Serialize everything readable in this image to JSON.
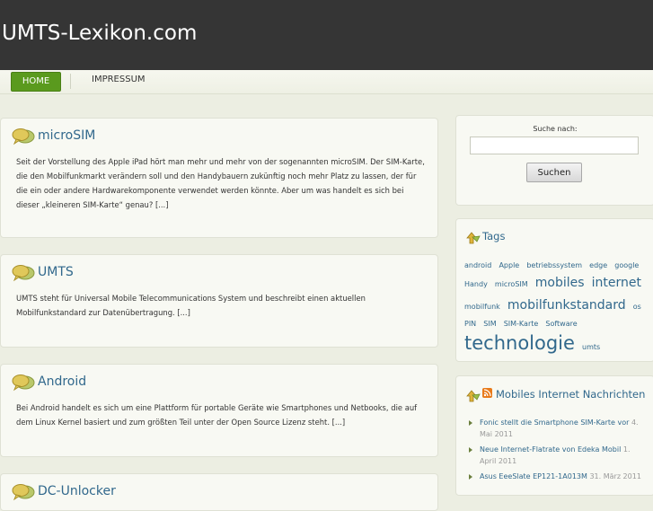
{
  "site": {
    "title": "UMTS-Lexikon.com"
  },
  "nav": {
    "home": "HOME",
    "impressum": "IMPRESSUM"
  },
  "posts": [
    {
      "title": "microSIM",
      "excerpt": "Seit der Vorstellung des Apple iPad hört man mehr und mehr von der sogenannten microSIM. Der SIM-Karte, die den Mobilfunkmarkt verändern soll und den Handybauern zukünftig noch mehr Platz zu lassen, der für die ein oder andere Hardwarekomponente verwendet werden könnte. Aber um was handelt es sich bei dieser „kleineren SIM-Karte“ genau? [...]"
    },
    {
      "title": "UMTS",
      "excerpt": "UMTS steht für Universal Mobile Telecommunications System und beschreibt einen aktuellen Mobilfunkstandard zur Datenübertragung. [...]"
    },
    {
      "title": "Android",
      "excerpt": "Bei Android handelt es sich um eine Plattform für portable Geräte wie Smartphones und Netbooks, die auf dem Linux Kernel basiert und zum größten Teil unter der Open Source Lizenz steht. [...]"
    },
    {
      "title": "DC-Unlocker",
      "excerpt": ""
    }
  ],
  "search": {
    "label": "Suche nach:",
    "value": "",
    "button": "Suchen"
  },
  "tags": {
    "title": "Tags",
    "items": [
      {
        "label": "android",
        "size": 8
      },
      {
        "label": "Apple",
        "size": 8
      },
      {
        "label": "betriebssystem",
        "size": 8
      },
      {
        "label": "edge",
        "size": 8
      },
      {
        "label": "google",
        "size": 8
      },
      {
        "label": "Handy",
        "size": 8
      },
      {
        "label": "microSIM",
        "size": 8
      },
      {
        "label": "mobiles",
        "size": 14
      },
      {
        "label": "internet",
        "size": 14
      },
      {
        "label": "mobilfunk",
        "size": 8
      },
      {
        "label": "mobilfunkstandard",
        "size": 14
      },
      {
        "label": "os",
        "size": 8
      },
      {
        "label": "PIN",
        "size": 8
      },
      {
        "label": "SIM",
        "size": 8
      },
      {
        "label": "SIM-Karte",
        "size": 8
      },
      {
        "label": "Software",
        "size": 8
      },
      {
        "label": "technologie",
        "size": 21
      },
      {
        "label": "umts",
        "size": 8
      }
    ]
  },
  "news": {
    "title": "Mobiles Internet Nachrichten",
    "items": [
      {
        "text": "Fonic stellt die Smartphone SIM-Karte vor",
        "date": "4. Mai 2011"
      },
      {
        "text": "Neue Internet-Flatrate von Edeka Mobil",
        "date": "1. April 2011"
      },
      {
        "text": "Asus EeeSlate EP121-1A013M",
        "date": "31. März 2011"
      }
    ]
  }
}
